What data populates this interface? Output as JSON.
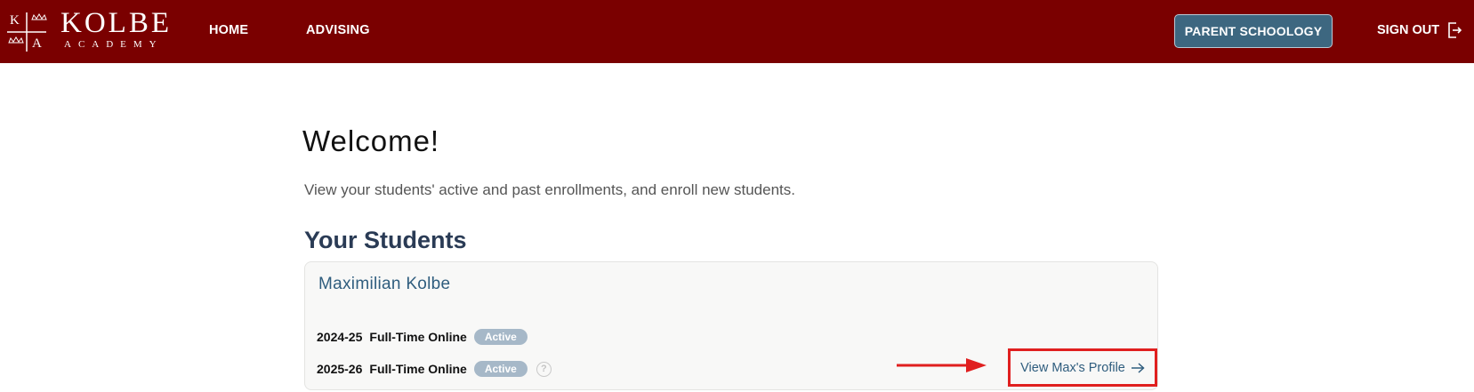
{
  "brand": {
    "mark_letters": [
      "K",
      "A"
    ],
    "word": "KOLBE",
    "sub": "ACADEMY"
  },
  "nav": {
    "home": "HOME",
    "advising": "ADVISING",
    "parent_schoology": "PARENT SCHOOLOGY",
    "sign_out": "SIGN OUT"
  },
  "main": {
    "title": "Welcome!",
    "subtitle": "View your students' active and past enrollments, and enroll new students.",
    "section_title": "Your Students"
  },
  "students": [
    {
      "name": "Maximilian Kolbe",
      "enrollments": [
        {
          "year": "2024-25",
          "program": "Full-Time Online",
          "status": "Active"
        },
        {
          "year": "2025-26",
          "program": "Full-Time Online",
          "status": "Active",
          "help": "?"
        }
      ],
      "profile_link": "View Max's Profile"
    }
  ],
  "colors": {
    "header": "#7a0000",
    "button": "#3d6780",
    "badge": "#a6b8c8",
    "link": "#2f5d7e",
    "highlight": "#e01f1f"
  },
  "icons": {
    "sign_out": "sign-out-icon",
    "profile_arrow": "arrow-right-icon",
    "annotation": "red-arrow-icon",
    "help": "help-icon"
  }
}
